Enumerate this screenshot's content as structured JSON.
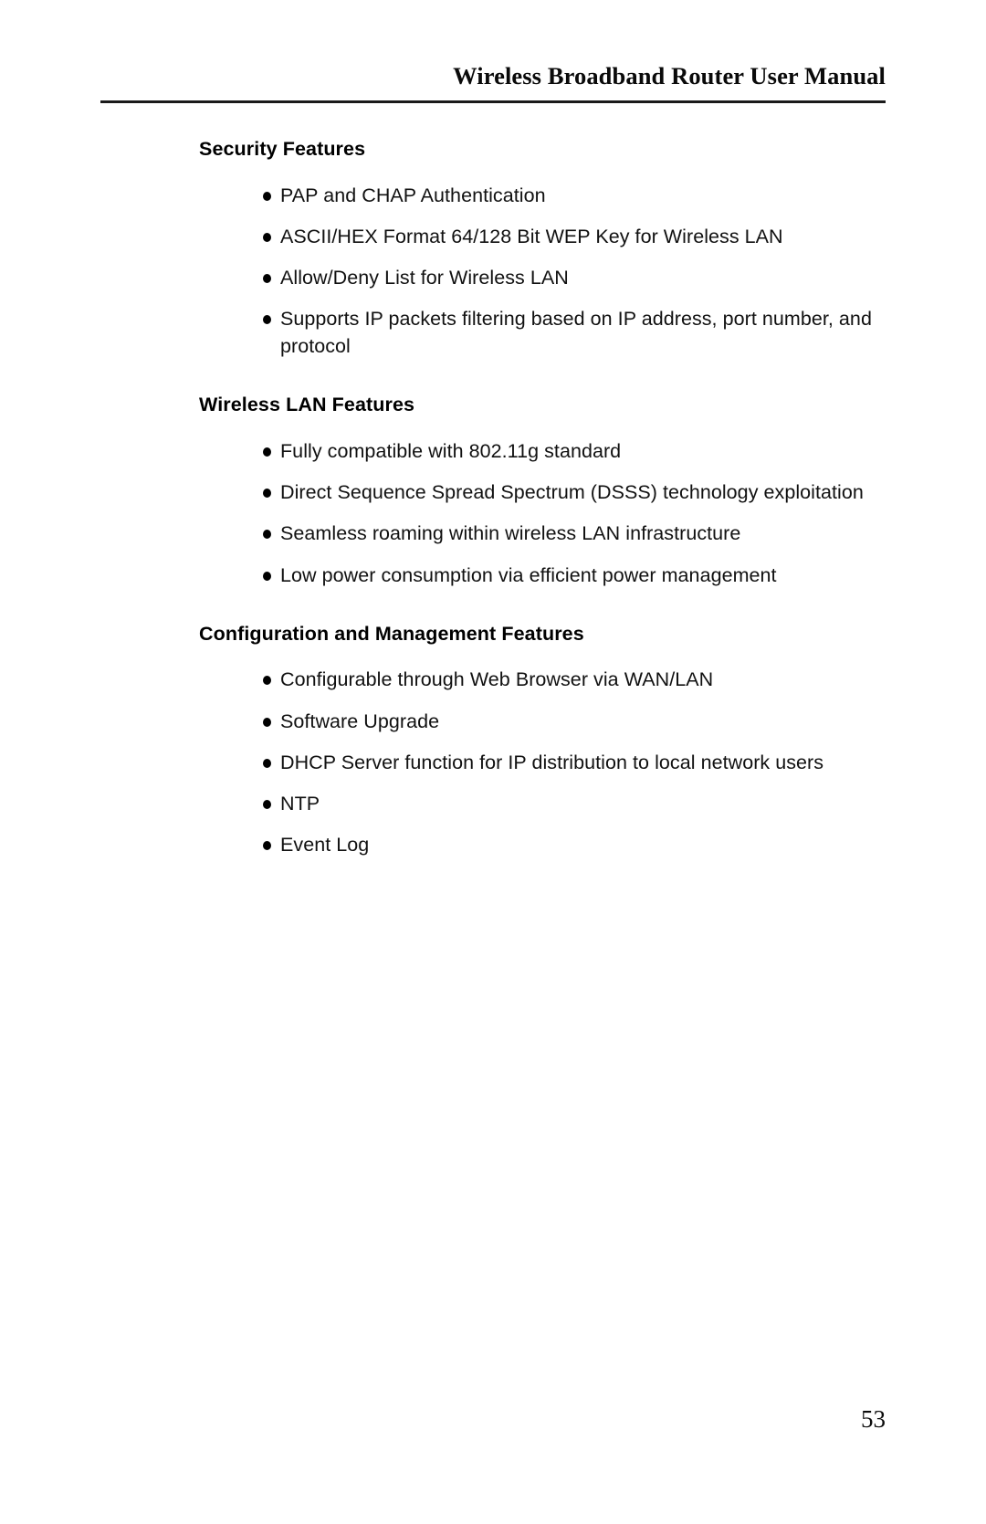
{
  "header": {
    "title": "Wireless Broadband Router User Manual"
  },
  "sections": [
    {
      "heading": "Security Features",
      "bullets": [
        "PAP and CHAP Authentication",
        "ASCII/HEX Format 64/128 Bit WEP Key for Wireless LAN",
        "Allow/Deny List for Wireless LAN",
        "Supports IP packets filtering based on IP address, port number, and protocol"
      ]
    },
    {
      "heading": "Wireless LAN Features",
      "bullets": [
        "Fully compatible with 802.11g standard",
        "Direct Sequence Spread Spectrum (DSSS) technology exploitation",
        "Seamless roaming within wireless LAN infrastructure",
        "Low power consumption via efficient power management"
      ]
    },
    {
      "heading": "Configuration and Management Features",
      "bullets": [
        "Configurable through Web Browser via WAN/LAN",
        "Software Upgrade",
        "DHCP Server function for IP distribution to local network users",
        "NTP",
        "Event Log"
      ]
    }
  ],
  "footer": {
    "page_number": "53"
  }
}
